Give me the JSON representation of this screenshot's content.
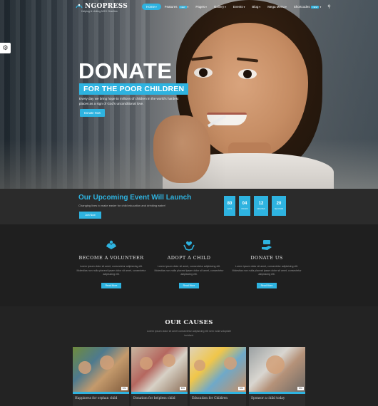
{
  "header": {
    "logo_text": "NGOPRESS",
    "tagline": "Helping & Uniting NGO Charities",
    "nav": [
      {
        "label": "Home",
        "active": true,
        "caret": true,
        "badge": ""
      },
      {
        "label": "Features",
        "active": false,
        "caret": true,
        "badge": "NEW"
      },
      {
        "label": "Pages",
        "active": false,
        "caret": true,
        "badge": ""
      },
      {
        "label": "Gallery",
        "active": false,
        "caret": true,
        "badge": ""
      },
      {
        "label": "Events",
        "active": false,
        "caret": true,
        "badge": ""
      },
      {
        "label": "Blog",
        "active": false,
        "caret": true,
        "badge": ""
      },
      {
        "label": "Mega Menu",
        "active": false,
        "caret": true,
        "badge": ""
      },
      {
        "label": "Shortcodes",
        "active": false,
        "caret": true,
        "badge": "NEW"
      }
    ]
  },
  "hero": {
    "title": "DONATE",
    "subtitle": "FOR THE POOR CHILDREN",
    "description": "Every day we bring hope to millions of children in the world's hardest places as a sign of God's unconditional love.",
    "button": "Donate Now"
  },
  "event": {
    "title": "Our Upcoming Event Will Launch",
    "subtitle": "Changing lives to make easier for child education and drinking water!",
    "button": "Join Now",
    "countdown": [
      {
        "value": "80",
        "unit": "DAYS"
      },
      {
        "value": "04",
        "unit": "HOURS"
      },
      {
        "value": "12",
        "unit": "MINUTES"
      },
      {
        "value": "20",
        "unit": "SECONDS"
      }
    ]
  },
  "features": [
    {
      "icon": "volunteer-hands-icon",
      "title": "BECOME A VOLUNTEER",
      "text": "Lorem ipsum dolor sit amet, consectetur adipisicing elit. Molestias non nulla placeat ipsam dolor sit amet, consectetur adipisicing elit.",
      "button": "Read More"
    },
    {
      "icon": "heart-hands-icon",
      "title": "ADOPT A CHILD",
      "text": "Lorem ipsum dolor sit amet, consectetur adipisicing elit. Molestias non nulla placeat ipsam dolor sit amet, consectetur adipisicing elit.",
      "button": "Read More"
    },
    {
      "icon": "donate-hand-icon",
      "title": "DONATE US",
      "text": "Lorem ipsum dolor sit amet, consectetur adipisicing elit. Molestias non nulla placeat ipsam dolor sit amet, consectetur adipisicing elit.",
      "button": "Read More"
    }
  ],
  "causes": {
    "title": "OUR CAUSES",
    "subtitle": "Lorem ipsum dolor sit amet consectetur adipisicing elit sem nulla voluptate incidunt.",
    "cards": [
      {
        "title": "Happiness for orphan child",
        "tag": "50%"
      },
      {
        "title": "Donation for helpless child",
        "tag": "50%"
      },
      {
        "title": "Education for Children",
        "tag": "50%"
      },
      {
        "title": "Sponsor a child today",
        "tag": "50%"
      }
    ]
  },
  "colors": {
    "accent": "#2eb3e0",
    "dark_bg": "#1f1f1f",
    "bar_bg": "#2b2b2b"
  }
}
